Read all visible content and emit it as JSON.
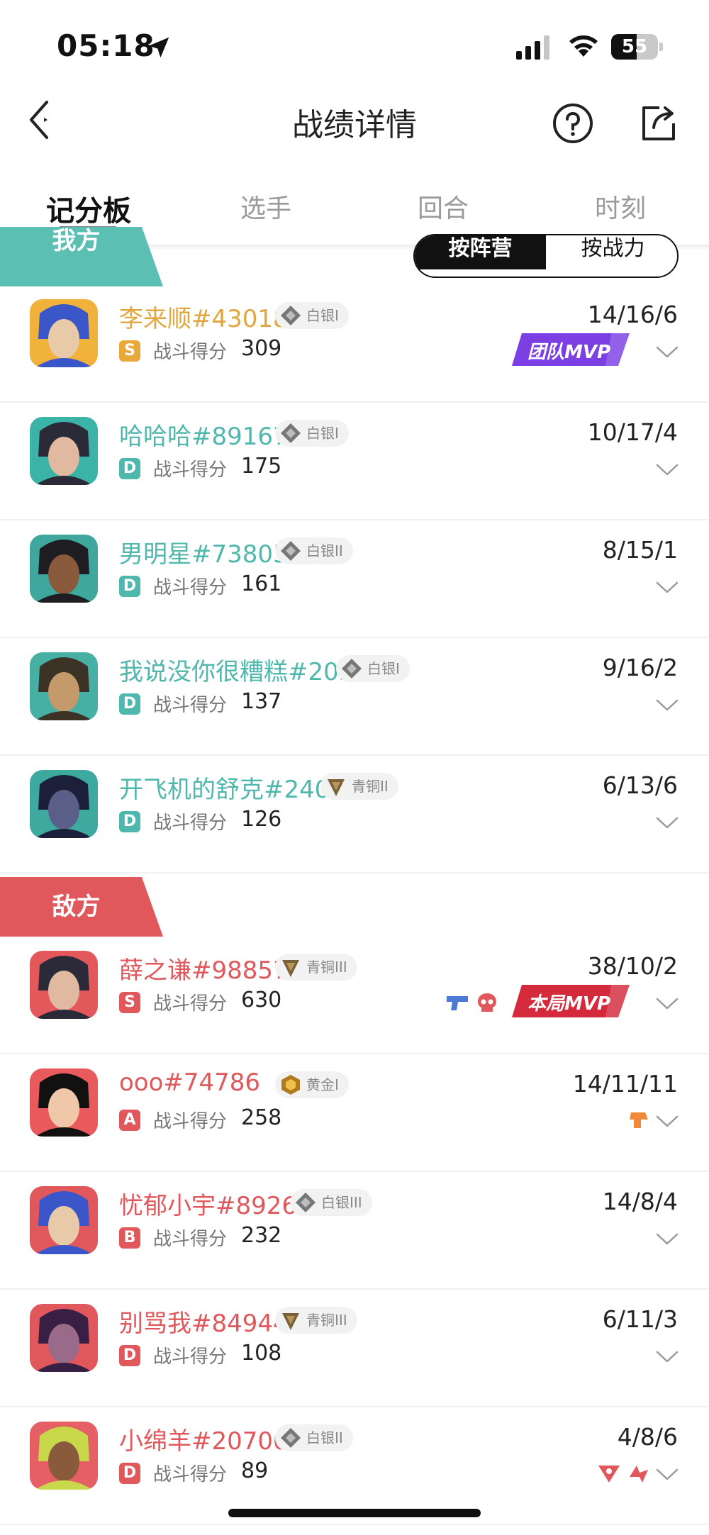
{
  "status_bar": {
    "time": "05:18",
    "battery": "55",
    "battery_level": 0.55
  },
  "nav": {
    "title": "战绩详情"
  },
  "tabs": [
    {
      "label": "记分板",
      "active": true
    },
    {
      "label": "选手",
      "active": false
    },
    {
      "label": "回合",
      "active": false
    },
    {
      "label": "时刻",
      "active": false
    }
  ],
  "toggle": {
    "option_a": "按阵营",
    "option_b": "按战力",
    "selected": "按阵营"
  },
  "colors": {
    "ally_accent": "#5cbfb3",
    "enemy_accent": "#e0585b",
    "mvp_team": "#7b3fe4",
    "mvp_match": "#d42a3c",
    "grade_s": "#e8a93a",
    "grade_a": "#e0585b",
    "grade_b": "#e0585b",
    "grade_d_ally": "#4fb8ad",
    "grade_d_enemy": "#e0585b"
  },
  "ally": {
    "label": "我方",
    "players": [
      {
        "name": "李来顺#43018",
        "rank": "白银I",
        "rank_icon": "silver-rank-icon",
        "grade": "S",
        "score_label": "战斗得分",
        "score": "309",
        "kda": "14/16/6",
        "badge": "团队MVP",
        "name_color": "#e3a63c"
      },
      {
        "name": "哈哈哈#89167",
        "rank": "白银I",
        "rank_icon": "silver-rank-icon",
        "grade": "D",
        "score_label": "战斗得分",
        "score": "175",
        "kda": "10/17/4",
        "badge": "",
        "name_color": "#4fb8ad"
      },
      {
        "name": "男明星#73805",
        "rank": "白银II",
        "rank_icon": "silver-rank-icon",
        "grade": "D",
        "score_label": "战斗得分",
        "score": "161",
        "kda": "8/15/1",
        "badge": "",
        "name_color": "#4fb8ad"
      },
      {
        "name": "我说没你很糟糕#20559",
        "rank": "白银I",
        "rank_icon": "silver-rank-icon",
        "grade": "D",
        "score_label": "战斗得分",
        "score": "137",
        "kda": "9/16/2",
        "badge": "",
        "name_color": "#4fb8ad"
      },
      {
        "name": "开飞机的舒克#24009",
        "rank": "青铜II",
        "rank_icon": "bronze-rank-icon",
        "grade": "D",
        "score_label": "战斗得分",
        "score": "126",
        "kda": "6/13/6",
        "badge": "",
        "name_color": "#4fb8ad"
      }
    ]
  },
  "enemy": {
    "label": "敌方",
    "players": [
      {
        "name": "薛之谦#98857",
        "rank": "青铜III",
        "rank_icon": "bronze-rank-icon",
        "grade": "S",
        "score_label": "战斗得分",
        "score": "630",
        "kda": "38/10/2",
        "badge": "本局MVP",
        "extra_icons": [
          "gun-icon",
          "skull-icon"
        ],
        "name_color": "#e0585b"
      },
      {
        "name": "ooo#74786",
        "rank": "黄金I",
        "rank_icon": "gold-rank-icon",
        "grade": "A",
        "score_label": "战斗得分",
        "score": "258",
        "kda": "14/11/11",
        "badge": "",
        "extra_icons": [
          "clutch-icon"
        ],
        "name_color": "#e0585b"
      },
      {
        "name": "忧郁小宇#89260",
        "rank": "白银III",
        "rank_icon": "silver-rank-icon",
        "grade": "B",
        "score_label": "战斗得分",
        "score": "232",
        "kda": "14/8/4",
        "badge": "",
        "extra_icons": [],
        "name_color": "#e0585b"
      },
      {
        "name": "别骂我#84944",
        "rank": "青铜III",
        "rank_icon": "bronze-rank-icon",
        "grade": "D",
        "score_label": "战斗得分",
        "score": "108",
        "kda": "6/11/3",
        "badge": "",
        "extra_icons": [],
        "name_color": "#e0585b"
      },
      {
        "name": "小绵羊#20700",
        "rank": "白银II",
        "rank_icon": "silver-rank-icon",
        "grade": "D",
        "score_label": "战斗得分",
        "score": "89",
        "kda": "4/8/6",
        "badge": "",
        "extra_icons": [
          "triangle-icon",
          "arrow-icon"
        ],
        "name_color": "#e0585b"
      }
    ]
  }
}
